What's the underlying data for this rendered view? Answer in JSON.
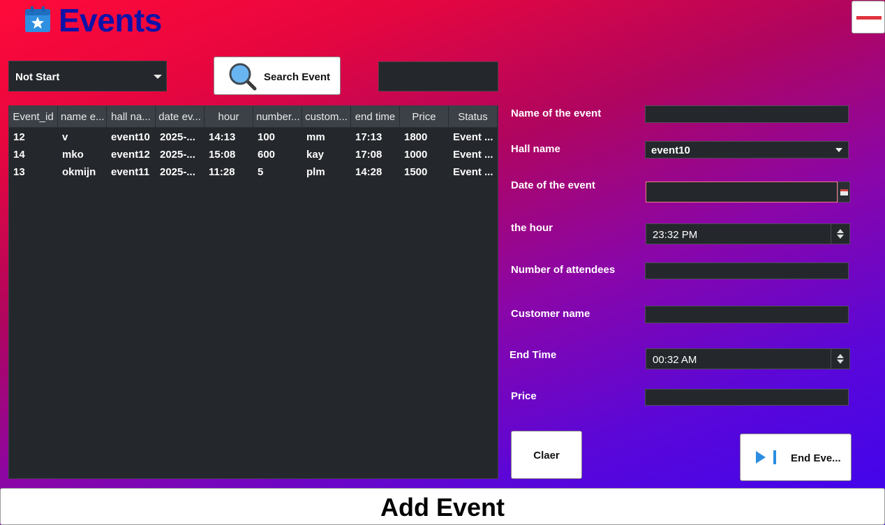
{
  "header": {
    "title": "Events",
    "minimize_icon": "minus-icon",
    "title_icon": "calendar-star-icon"
  },
  "toolbar": {
    "status_filter": "Not Start",
    "search_button": "Search Event",
    "search_value": ""
  },
  "table": {
    "columns": [
      "Event_id",
      "name e...",
      "hall na...",
      "date ev...",
      "hour",
      "number...",
      "custom...",
      "end time",
      "Price",
      "Status"
    ],
    "rows": [
      [
        "12",
        "v",
        "event10",
        "2025-...",
        "14:13",
        "100",
        "mm",
        "17:13",
        "1800",
        "Event ..."
      ],
      [
        "14",
        "mko",
        "event12",
        "2025-...",
        "15:08",
        "600",
        "kay",
        "17:08",
        "1000",
        "Event ..."
      ],
      [
        "13",
        "okmijn",
        "event11",
        "2025-...",
        "11:28",
        "5",
        "plm",
        "14:28",
        "1500",
        "Event ..."
      ]
    ]
  },
  "form": {
    "name_label": "Name of the event",
    "hall_label": "Hall name",
    "hall_value": "event10",
    "date_label": "Date of the event",
    "hour_label": "the hour",
    "hour_value": "23:32 PM",
    "attendees_label": "Number of attendees",
    "customer_label": "Customer name",
    "end_time_label": "End Time",
    "end_time_value": "00:32 AM",
    "price_label": "Price",
    "clear_button": "Claer",
    "end_button": "End Eve..."
  },
  "footer": {
    "add_button": "Add Event"
  },
  "colors": {
    "title": "#0d12a8",
    "field_bg": "#24272b",
    "header_bg": "#3b4147",
    "accent": "#e0343f"
  }
}
